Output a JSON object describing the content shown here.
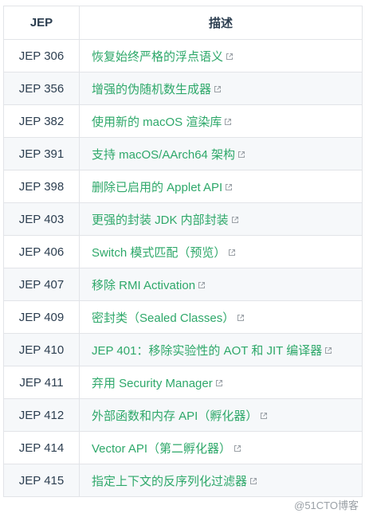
{
  "table": {
    "headers": [
      "JEP",
      "描述"
    ],
    "rows": [
      {
        "jep": "JEP 306",
        "desc": "恢复始终严格的浮点语义"
      },
      {
        "jep": "JEP 356",
        "desc": "增强的伪随机数生成器"
      },
      {
        "jep": "JEP 382",
        "desc": "使用新的 macOS 渲染库"
      },
      {
        "jep": "JEP 391",
        "desc": "支持 macOS/AArch64 架构"
      },
      {
        "jep": "JEP 398",
        "desc": "删除已启用的 Applet API"
      },
      {
        "jep": "JEP 403",
        "desc": "更强的封装 JDK 内部封装"
      },
      {
        "jep": "JEP 406",
        "desc": "Switch 模式匹配（预览）"
      },
      {
        "jep": "JEP 407",
        "desc": "移除 RMI Activation"
      },
      {
        "jep": "JEP 409",
        "desc": "密封类（Sealed Classes）"
      },
      {
        "jep": "JEP 410",
        "desc": "JEP 401：移除实验性的 AOT 和 JIT 编译器"
      },
      {
        "jep": "JEP 411",
        "desc": "弃用 Security Manager"
      },
      {
        "jep": "JEP 412",
        "desc": "外部函数和内存 API（孵化器）"
      },
      {
        "jep": "JEP 414",
        "desc": "Vector API（第二孵化器）"
      },
      {
        "jep": "JEP 415",
        "desc": "指定上下文的反序列化过滤器"
      }
    ]
  },
  "link_icon": "external-link-icon",
  "colors": {
    "link": "#2ea86a",
    "text": "#2c3e50",
    "stripe": "#f6f8fa",
    "border": "#e2e4e8"
  },
  "watermark": "@51CTO博客"
}
